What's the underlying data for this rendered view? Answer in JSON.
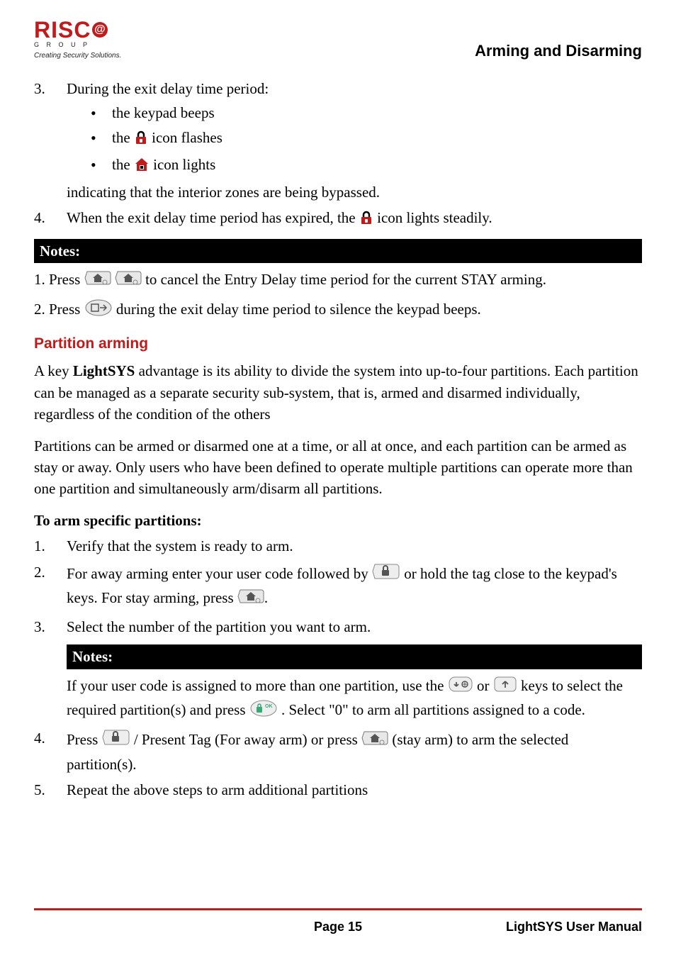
{
  "header": {
    "logo_text": "RISC",
    "logo_group": "G R O U P",
    "logo_tagline": "Creating Security Solutions.",
    "title": "Arming and Disarming"
  },
  "list_a": {
    "item3_text": "During the exit delay time period:",
    "sub1": "the keypad beeps",
    "sub2_pre": "the ",
    "sub2_post": " icon flashes",
    "sub3_pre": "the ",
    "sub3_post": " icon lights",
    "indicating": "indicating that the interior zones are being bypassed.",
    "item4_pre": "When the exit delay time period has expired, the ",
    "item4_post": " icon lights steadily."
  },
  "notes1": {
    "label": "Notes:",
    "n1_pre": "1. Press ",
    "n1_post": " to cancel the Entry Delay time period for the current STAY arming.",
    "n2_pre": "2. Press ",
    "n2_post": " during the exit delay time period to silence the keypad beeps."
  },
  "section": {
    "title": "Partition arming",
    "p1_pre": "A key ",
    "p1_bold": "LightSYS",
    "p1_post": " advantage is its ability to divide the system into up-to-four partitions. Each partition can be managed as a separate security sub-system, that is, armed and disarmed individually, regardless of the condition of the others",
    "p2": "Partitions can be armed or disarmed one at a time, or all at once, and each partition can be armed as stay or away. Only users who have been defined to operate multiple partitions can operate more than one partition and simultaneously arm/disarm all partitions.",
    "heading": "To arm specific partitions:",
    "s1": "Verify that the system is ready to arm.",
    "s2_pre": "For away arming enter your user code followed by ",
    "s2_mid": " or hold the tag close to the keypad's keys.  For stay arming, press ",
    "s2_post": ".",
    "s3": "Select the number of the partition you want to arm.",
    "notes_label": "Notes:",
    "note_pre": "If your user code is assigned to more than one partition, use the ",
    "note_mid1": " or ",
    "note_mid2": " keys to select the required partition(s) and press ",
    "note_post": ". Select \"0\" to arm all partitions assigned to a code.",
    "s4_pre": "Press ",
    "s4_mid1": "/ Present Tag (For away arm) or press ",
    "s4_post": " (stay arm) to arm the selected partition(s).",
    "s5": "Repeat the above steps to arm additional partitions"
  },
  "footer": {
    "page": "Page 15",
    "manual": "LightSYS User Manual"
  }
}
